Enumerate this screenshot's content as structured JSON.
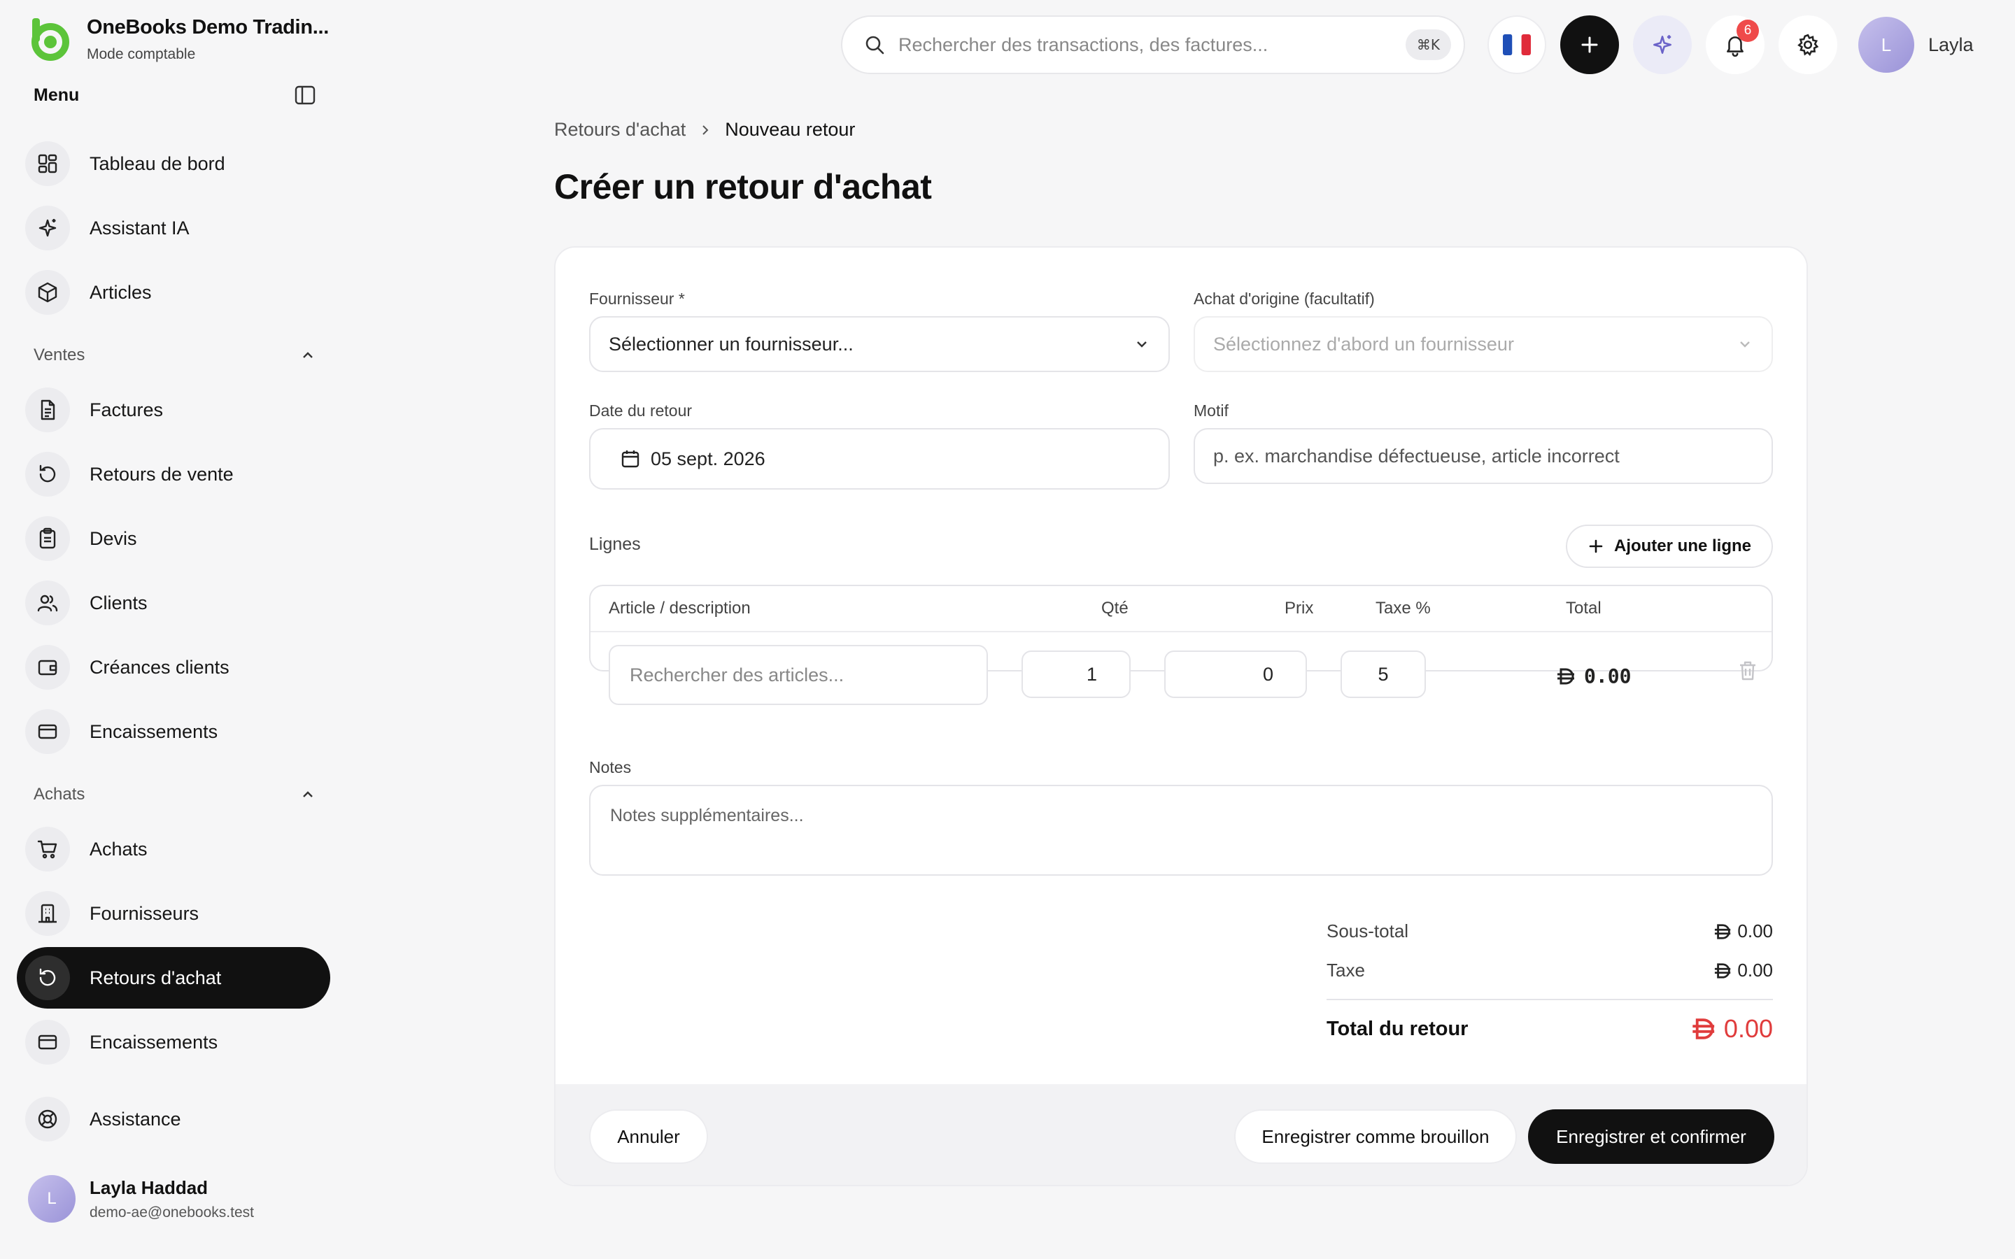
{
  "app": {
    "name": "OneBooks Demo Tradin...",
    "mode": "Mode comptable"
  },
  "sidebar": {
    "menu_title": "Menu",
    "top_items": [
      {
        "label": "Tableau de bord",
        "icon": "dashboard-icon"
      },
      {
        "label": "Assistant IA",
        "icon": "sparkles-icon"
      },
      {
        "label": "Articles",
        "icon": "package-icon"
      }
    ],
    "sales_section": "Ventes",
    "sales_items": [
      {
        "label": "Factures",
        "icon": "file-icon"
      },
      {
        "label": "Retours de vente",
        "icon": "rotate-ccw-icon"
      },
      {
        "label": "Devis",
        "icon": "clipboard-icon"
      },
      {
        "label": "Clients",
        "icon": "users-icon"
      },
      {
        "label": "Créances clients",
        "icon": "wallet-icon"
      },
      {
        "label": "Encaissements",
        "icon": "credit-card-icon"
      }
    ],
    "purchases_section": "Achats",
    "purchase_items": [
      {
        "label": "Achats",
        "icon": "cart-icon"
      },
      {
        "label": "Fournisseurs",
        "icon": "building-icon"
      },
      {
        "label": "Retours d'achat",
        "icon": "rotate-ccw-icon",
        "active": true
      },
      {
        "label": "Encaissements",
        "icon": "credit-card-icon"
      }
    ],
    "support_item": {
      "label": "Assistance",
      "icon": "lifebuoy-icon"
    },
    "user": {
      "initial": "L",
      "name": "Layla Haddad",
      "email": "demo-ae@onebooks.test"
    }
  },
  "topbar": {
    "search_placeholder": "Rechercher des transactions, des factures...",
    "shortcut": "⌘K",
    "notifications_count": "6",
    "user_initial": "L",
    "user_name": "Layla"
  },
  "breadcrumb": {
    "parent": "Retours d'achat",
    "current": "Nouveau retour"
  },
  "page_title": "Créer un retour d'achat",
  "form": {
    "supplier": {
      "label": "Fournisseur *",
      "placeholder": "Sélectionner un fournisseur..."
    },
    "origin": {
      "label": "Achat d'origine (facultatif)",
      "placeholder": "Sélectionnez d'abord un fournisseur"
    },
    "date": {
      "label": "Date du retour",
      "value": "05 sept. 2026"
    },
    "reason": {
      "label": "Motif",
      "placeholder": "p. ex. marchandise défectueuse, article incorrect"
    },
    "lines_label": "Lignes",
    "add_line_label": "Ajouter une ligne",
    "columns": {
      "article": "Article / description",
      "qty": "Qté",
      "price": "Prix",
      "tax": "Taxe %",
      "total": "Total"
    },
    "line": {
      "article_placeholder": "Rechercher des articles...",
      "qty": "1",
      "price": "0",
      "tax": "5",
      "total": "0.00"
    },
    "notes_label": "Notes",
    "notes_placeholder": "Notes supplémentaires..."
  },
  "summary": {
    "subtotal_label": "Sous-total",
    "subtotal_value": "0.00",
    "tax_label": "Taxe",
    "tax_value": "0.00",
    "total_label": "Total du retour",
    "total_value": "0.00"
  },
  "actions": {
    "cancel": "Annuler",
    "draft": "Enregistrer comme brouillon",
    "confirm": "Enregistrer et confirmer"
  },
  "colors": {
    "accent_dark": "#111111",
    "brand_green": "#5cc43a",
    "total_red": "#e03c3c",
    "notif_red": "#ef4a4a"
  }
}
